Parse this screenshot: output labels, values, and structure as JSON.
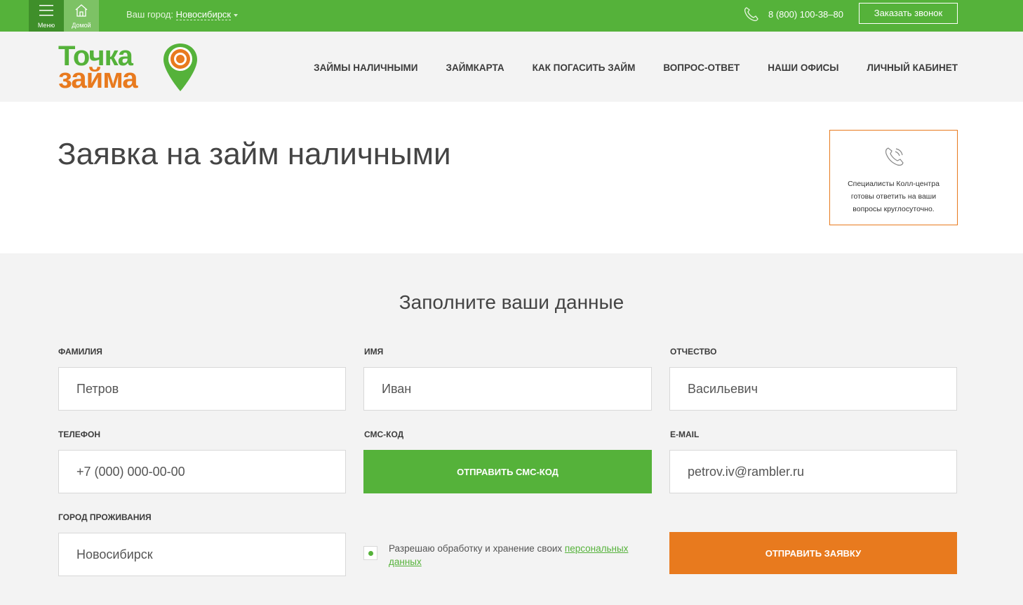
{
  "topbar": {
    "menu_label": "Меню",
    "home_label": "Домой",
    "city_prefix": "Ваш город:",
    "city_value": "Новосибирск",
    "phone": "8 (800) 100-38–80",
    "callback_label": "Заказать звонок"
  },
  "header": {
    "logo_line1": "Точка",
    "logo_line2": "займа",
    "nav": [
      {
        "label": "Займы наличными"
      },
      {
        "label": "Займкарта"
      },
      {
        "label": "Как погасить займ"
      },
      {
        "label": "Вопрос-ответ"
      },
      {
        "label": "Наши офисы"
      },
      {
        "label": "Личный кабинет"
      }
    ]
  },
  "page": {
    "title": "Заявка на займ наличными",
    "callcenter_text": "Специалисты Колл-центра готовы ответить на ваши вопросы круглосуточно."
  },
  "form": {
    "title": "Заполните ваши данные",
    "lastname": {
      "label": "Фамилия",
      "placeholder": "Петров"
    },
    "firstname": {
      "label": "Имя",
      "placeholder": "Иван"
    },
    "middlename": {
      "label": "Отчество",
      "placeholder": "Васильевич"
    },
    "phone": {
      "label": "Телефон",
      "placeholder": "+7 (000) 000-00-00"
    },
    "sms": {
      "label": "СМС-код",
      "button": "Отправить СМС-код"
    },
    "email": {
      "label": "E-mail",
      "placeholder": "petrov.iv@rambler.ru"
    },
    "city": {
      "label": "Город проживания",
      "placeholder": "Новосибирск"
    },
    "consent_text": "Разрешаю обработку и хранение своих",
    "consent_link": "персональных данных",
    "submit": "Отправить заявку"
  },
  "colors": {
    "brand_green": "#55b23a",
    "brand_orange": "#e87a1e"
  }
}
